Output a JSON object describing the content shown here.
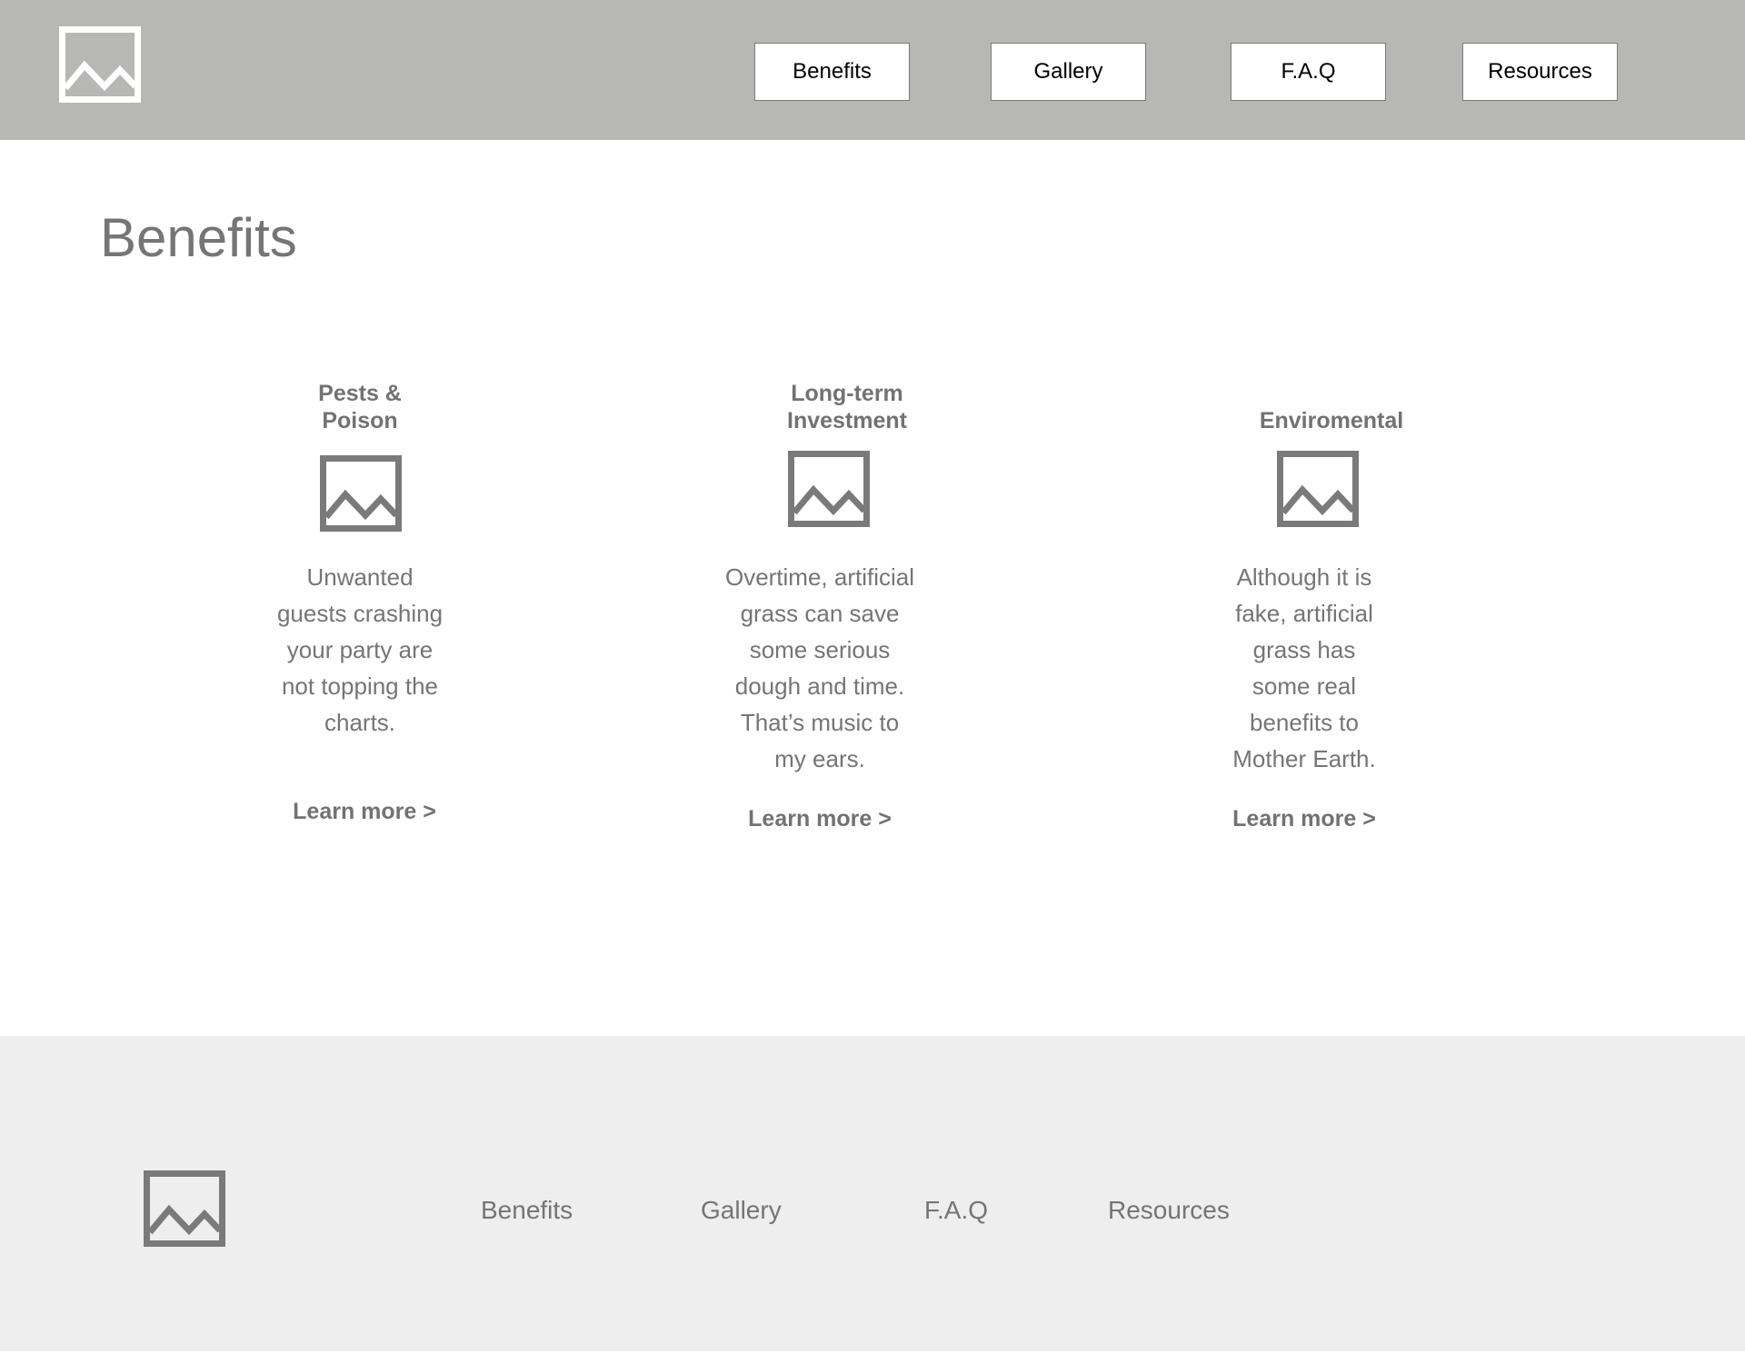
{
  "header": {
    "logo_icon": "image-placeholder-icon",
    "nav": {
      "benefits": "Benefits",
      "gallery": "Gallery",
      "faq": "F.A.Q",
      "resources": "Resources"
    }
  },
  "main": {
    "title": "Benefits",
    "cards": [
      {
        "title": "Pests &\nPoison",
        "icon": "image-placeholder-icon",
        "body": "Unwanted\nguests crashing\nyour party are\nnot topping the\ncharts.",
        "link": "Learn more >"
      },
      {
        "title": "Long-term\nInvestment",
        "icon": "image-placeholder-icon",
        "body": "Overtime, artificial\ngrass can save\nsome serious\ndough and time.\nThat’s music to\nmy ears.",
        "link": "Learn more >"
      },
      {
        "title": "Enviromental",
        "icon": "image-placeholder-icon",
        "body": "Although it is\nfake, artificial\ngrass has\nsome real\nbenefits to\nMother Earth.",
        "link": "Learn more >"
      }
    ]
  },
  "footer": {
    "logo_icon": "image-placeholder-icon",
    "links": {
      "benefits": "Benefits",
      "gallery": "Gallery",
      "faq": "F.A.Q",
      "resources": "Resources"
    }
  },
  "colors": {
    "header_bg": "#b7b7b6",
    "footer_bg": "#eeeeee",
    "text_gray": "#757575",
    "icon_gray": "#7a7a7a",
    "white": "#ffffff"
  }
}
